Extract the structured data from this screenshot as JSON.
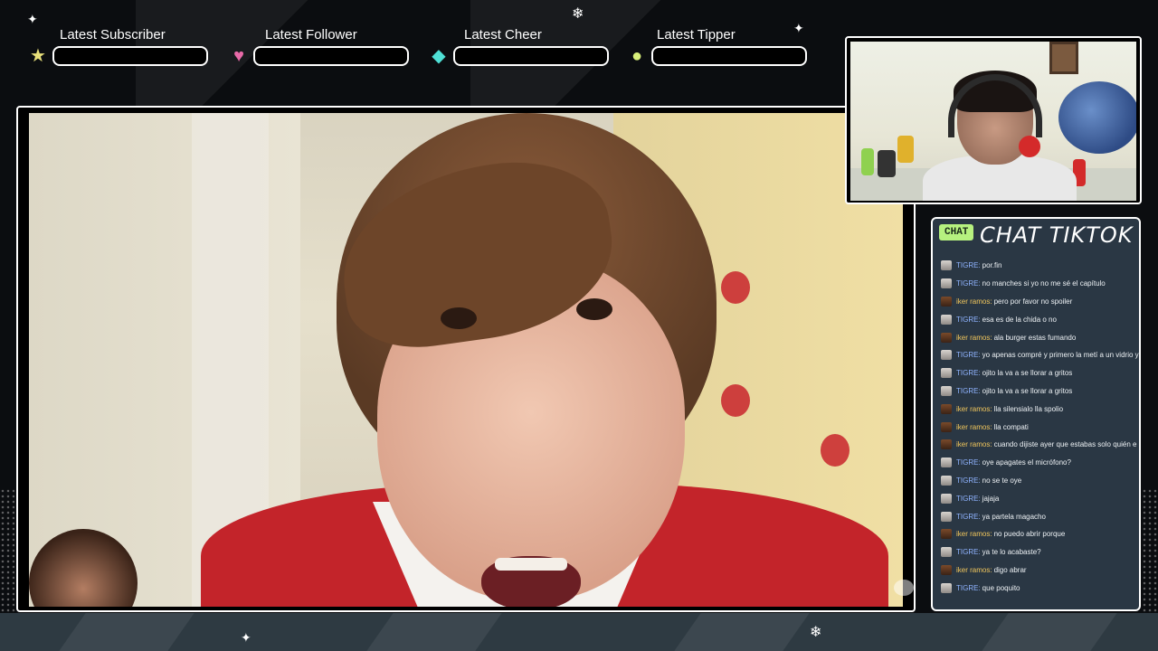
{
  "alerts": [
    {
      "label": "Latest Subscriber",
      "icon": "star-icon",
      "glyph": "★",
      "color": "#e8e07a"
    },
    {
      "label": "Latest Follower",
      "icon": "heart-icon",
      "glyph": "♥",
      "color": "#e86aa8"
    },
    {
      "label": "Latest Cheer",
      "icon": "gem-icon",
      "glyph": "◆",
      "color": "#4fe0d6"
    },
    {
      "label": "Latest Tipper",
      "icon": "coin-icon",
      "glyph": "●",
      "color": "#d8ef7a"
    }
  ],
  "chat": {
    "badge": "CHAT",
    "title": "CHAT TIKTOK",
    "messages": [
      {
        "user": "TIGRE:",
        "text": "por.fin",
        "avatar": "light"
      },
      {
        "user": "TIGRE:",
        "text": "no manches si yo no me sé el capítulo",
        "avatar": "light"
      },
      {
        "user": "iker ramos:",
        "text": "pero por favor no spoiler",
        "avatar": "dark"
      },
      {
        "user": "TIGRE:",
        "text": "esa es de la chida o no",
        "avatar": "light"
      },
      {
        "user": "iker ramos:",
        "text": "ala burger estas fumando",
        "avatar": "dark"
      },
      {
        "user": "TIGRE:",
        "text": "yo apenas compré y primero la metí a un vidrio y",
        "avatar": "light"
      },
      {
        "user": "TIGRE:",
        "text": "ojito la va a se llorar a gritos",
        "avatar": "light"
      },
      {
        "user": "TIGRE:",
        "text": "ojito la va a se llorar a gritos",
        "avatar": "light"
      },
      {
        "user": "iker ramos:",
        "text": "lla silensialo lla spolio",
        "avatar": "dark"
      },
      {
        "user": "iker ramos:",
        "text": "lla compati",
        "avatar": "dark"
      },
      {
        "user": "iker ramos:",
        "text": "cuando dijiste ayer que estabas solo quién e",
        "avatar": "dark"
      },
      {
        "user": "TIGRE:",
        "text": "oye apagates el micrófono?",
        "avatar": "light"
      },
      {
        "user": "TIGRE:",
        "text": "no se te oye",
        "avatar": "light"
      },
      {
        "user": "TIGRE:",
        "text": "jajaja",
        "avatar": "light"
      },
      {
        "user": "TIGRE:",
        "text": "ya partela magacho",
        "avatar": "light"
      },
      {
        "user": "iker ramos:",
        "text": "no puedo abrir porque",
        "avatar": "dark"
      },
      {
        "user": "TIGRE:",
        "text": "ya te lo acabaste?",
        "avatar": "light"
      },
      {
        "user": "iker ramos:",
        "text": "digo abrar",
        "avatar": "dark"
      },
      {
        "user": "TIGRE:",
        "text": "que poquito",
        "avatar": "light"
      }
    ]
  },
  "colors": {
    "tigre_user": "#8fb3ff",
    "iker_user": "#f2c75c",
    "chat_bg": "#2a3744",
    "chat_badge": "#b6f17f"
  }
}
